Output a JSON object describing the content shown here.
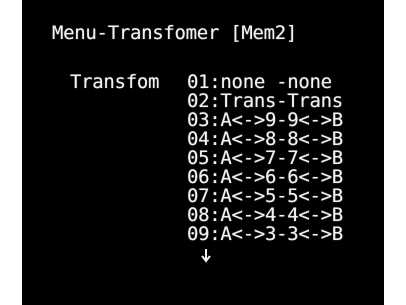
{
  "menu": {
    "title": "Menu-Transfomer [Mem2]",
    "field_label": "Transfom",
    "items": [
      "01:none -none",
      "02:Trans-Trans",
      "03:A<->9-9<->B",
      "04:A<->8-8<->B",
      "05:A<->7-7<->B",
      "06:A<->6-6<->B",
      "07:A<->5-5<->B",
      "08:A<->4-4<->B",
      "09:A<->3-3<->B"
    ],
    "more_indicator_icon": "arrow-down-icon"
  },
  "colors": {
    "screen_background": "#000000",
    "text": "#f2f2f2",
    "frame": "#ffffff"
  }
}
